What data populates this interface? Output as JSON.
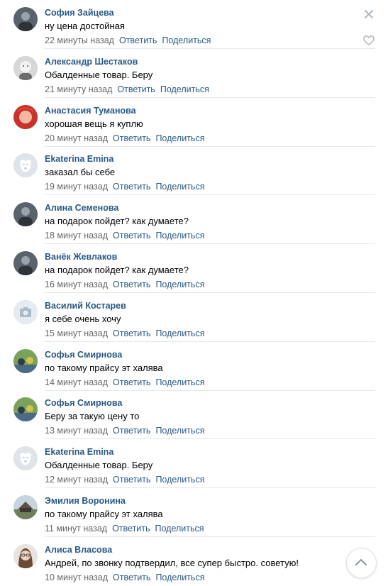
{
  "actions": {
    "reply": "Ответить",
    "share": "Поделиться"
  },
  "comments": [
    {
      "name": "София Зайцева",
      "text": "ну цена достойная",
      "time": "22 минуты назад",
      "avatar": "photo-dark-icon"
    },
    {
      "name": "Александр Шестаков",
      "text": "Обалденные товар. Беру",
      "time": "21 минуту назад",
      "avatar": "photo-child-icon"
    },
    {
      "name": "Анастасия Туманова",
      "text": "хорошая вещь я куплю",
      "time": "20 минут назад",
      "avatar": "photo-red-icon"
    },
    {
      "name": "Ekaterina Emina",
      "text": "заказал бы себе",
      "time": "19 минут назад",
      "avatar": "vk-dog-icon"
    },
    {
      "name": "Алина Семенова",
      "text": "на подарок пойдет? как думаете?",
      "time": "18 минут назад",
      "avatar": "photo-dark-icon"
    },
    {
      "name": "Ванёк Жевлаков",
      "text": "на подарок пойдет? как думаете?",
      "time": "16 минут назад",
      "avatar": "photo-dark-icon"
    },
    {
      "name": "Василий Костарев",
      "text": "я себе очень хочу",
      "time": "15 минут назад",
      "avatar": "camera-icon"
    },
    {
      "name": "Софья Смирнова",
      "text": "по такому прайсу эт халява",
      "time": "14 минут назад",
      "avatar": "photo-green-icon"
    },
    {
      "name": "Софья Смирнова",
      "text": "Беру за такую цену то",
      "time": "13 минут назад",
      "avatar": "photo-green-icon"
    },
    {
      "name": "Ekaterina Emina",
      "text": "Обалденные товар. Беру",
      "time": "12 минут назад",
      "avatar": "vk-dog-icon"
    },
    {
      "name": "Эмилия Воронина",
      "text": "по такому прайсу эт халява",
      "time": "11 минут назад",
      "avatar": "photo-landscape-icon"
    },
    {
      "name": "Алиса Власова",
      "text": "Андрей, по звонку подтвердил, все супер быстро. советую!",
      "time": "10 минут назад",
      "avatar": "photo-girl-icon"
    }
  ],
  "colors": {
    "name": "#2a5885",
    "meta": "#656565",
    "separator": "#e7e8ec"
  }
}
